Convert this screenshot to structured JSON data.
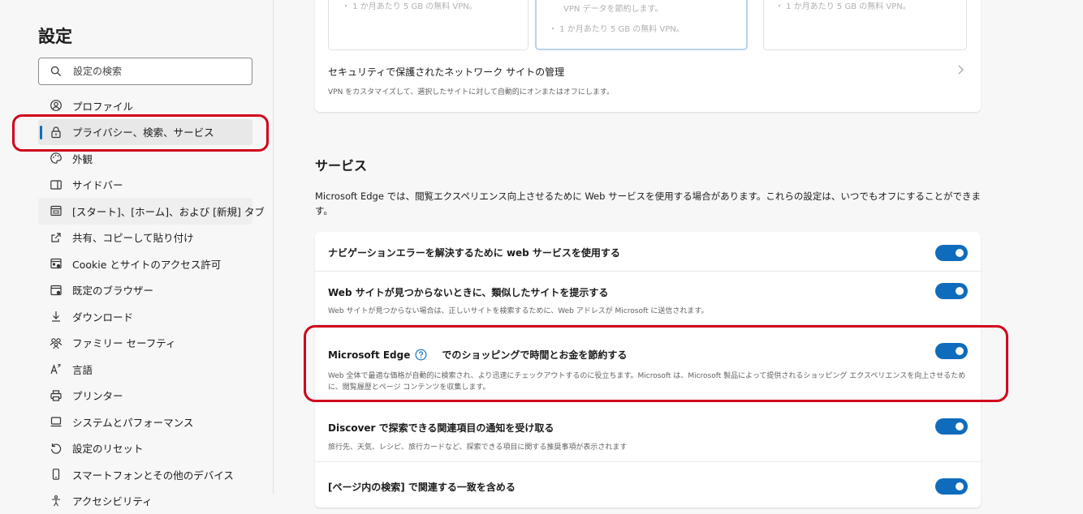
{
  "sidebar": {
    "title": "設定",
    "search_placeholder": "設定の検索",
    "items": [
      {
        "label": "プロファイル",
        "icon": "profile-icon"
      },
      {
        "label": "プライバシー、検索、サービス",
        "icon": "lock-icon",
        "active": true
      },
      {
        "label": "外観",
        "icon": "palette-icon"
      },
      {
        "label": "サイドバー",
        "icon": "sidebar-icon"
      },
      {
        "label": "[スタート]、[ホーム]、および [新規] タブ",
        "icon": "home-tab-icon"
      },
      {
        "label": "共有、コピーして貼り付け",
        "icon": "share-icon"
      },
      {
        "label": "Cookie とサイトのアクセス許可",
        "icon": "cookie-icon"
      },
      {
        "label": "既定のブラウザー",
        "icon": "browser-icon"
      },
      {
        "label": "ダウンロード",
        "icon": "download-icon"
      },
      {
        "label": "ファミリー セーフティ",
        "icon": "family-icon"
      },
      {
        "label": "言語",
        "icon": "language-icon"
      },
      {
        "label": "プリンター",
        "icon": "printer-icon"
      },
      {
        "label": "システムとパフォーマンス",
        "icon": "system-icon"
      },
      {
        "label": "設定のリセット",
        "icon": "reset-icon"
      },
      {
        "label": "スマートフォンとその他のデバイス",
        "icon": "phone-icon"
      },
      {
        "label": "アクセシビリティ",
        "icon": "accessibility-icon"
      }
    ]
  },
  "vpn": {
    "plan1_text": "・ 1 か月あたり 5 GB の無料 VPN。",
    "plan2_text1": "VPN データを節約します。",
    "plan2_text2": "・ 1 か月あたり 5 GB の無料 VPN。",
    "plan3_text": "・ 1 か月あたり 5 GB の無料 VPN。",
    "manage_title": "セキュリティで保護されたネットワーク サイトの管理",
    "manage_desc": "VPN をカスタマイズして、選択したサイトに対して自動的にオンまたはオフにします。"
  },
  "services": {
    "title": "サービス",
    "description": "Microsoft Edge では、閲覧エクスペリエンス向上させるために Web サービスを使用する場合があります。これらの設定は、いつでもオフにすることができます。",
    "rows": [
      {
        "title": "ナビゲーションエラーを解決するために web サービスを使用する",
        "desc": "",
        "on": true
      },
      {
        "title": "Web サイトが見つからないときに、類似したサイトを提示する",
        "desc": "Web サイトが見つからない場合は、正しいサイトを検索するために、Web アドレスが Microsoft に送信されます。",
        "on": true
      },
      {
        "title_a": "Microsoft Edge",
        "title_b": "でのショッピングで時間とお金を節約する",
        "desc": "Web 全体で最適な価格が自動的に検索され、より迅速にチェックアウトするのに役立ちます。Microsoft は、Microsoft 製品によって提供されるショッピング エクスペリエンスを向上させるために、閲覧履歴とページ コンテンツを収集します。",
        "on": true
      },
      {
        "title": "Discover で探索できる関連項目の通知を受け取る",
        "desc": "旅行先、天気、レシピ、旅行カードなど、探索できる項目に関する推奨事項が表示されます",
        "on": true
      },
      {
        "title": "[ページ内の検索] で関連する一致を含める",
        "desc": "",
        "on": true
      }
    ]
  },
  "colors": {
    "accent": "#0f6cbd",
    "annotation": "#d0021b"
  }
}
